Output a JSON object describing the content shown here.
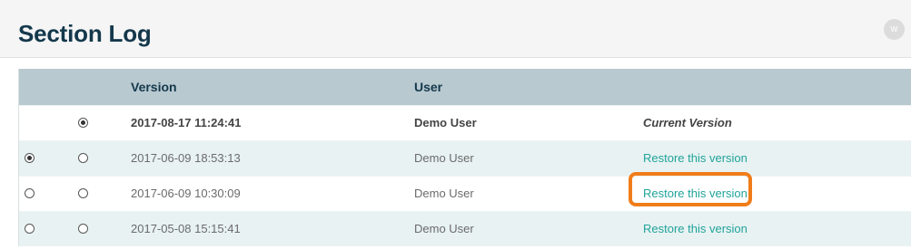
{
  "page": {
    "title": "Section Log",
    "avatar_initial": "w"
  },
  "table": {
    "columns": {
      "version": "Version",
      "user": "User"
    },
    "rows": [
      {
        "version": "2017-08-17 11:24:41",
        "user": "Demo User",
        "action": "Current Version",
        "radio_a_visible": false,
        "radio_a_selected": false,
        "radio_b_selected": true
      },
      {
        "version": "2017-06-09 18:53:13",
        "user": "Demo User",
        "action": "Restore this version",
        "radio_a_visible": true,
        "radio_a_selected": true,
        "radio_b_selected": false
      },
      {
        "version": "2017-06-09 10:30:09",
        "user": "Demo User",
        "action": "Restore this version",
        "radio_a_visible": true,
        "radio_a_selected": false,
        "radio_b_selected": false
      },
      {
        "version": "2017-05-08 15:15:41",
        "user": "Demo User",
        "action": "Restore this version",
        "radio_a_visible": true,
        "radio_a_selected": false,
        "radio_b_selected": false
      }
    ]
  },
  "colors": {
    "title": "#14384b",
    "header_bg": "#b8c9d0",
    "alt_row_bg": "#e8f2f2",
    "link": "#21a39b",
    "highlight": "#f07d1a"
  },
  "icons": {
    "avatar": "user-avatar-icon",
    "radio": "radio-button-icon"
  }
}
